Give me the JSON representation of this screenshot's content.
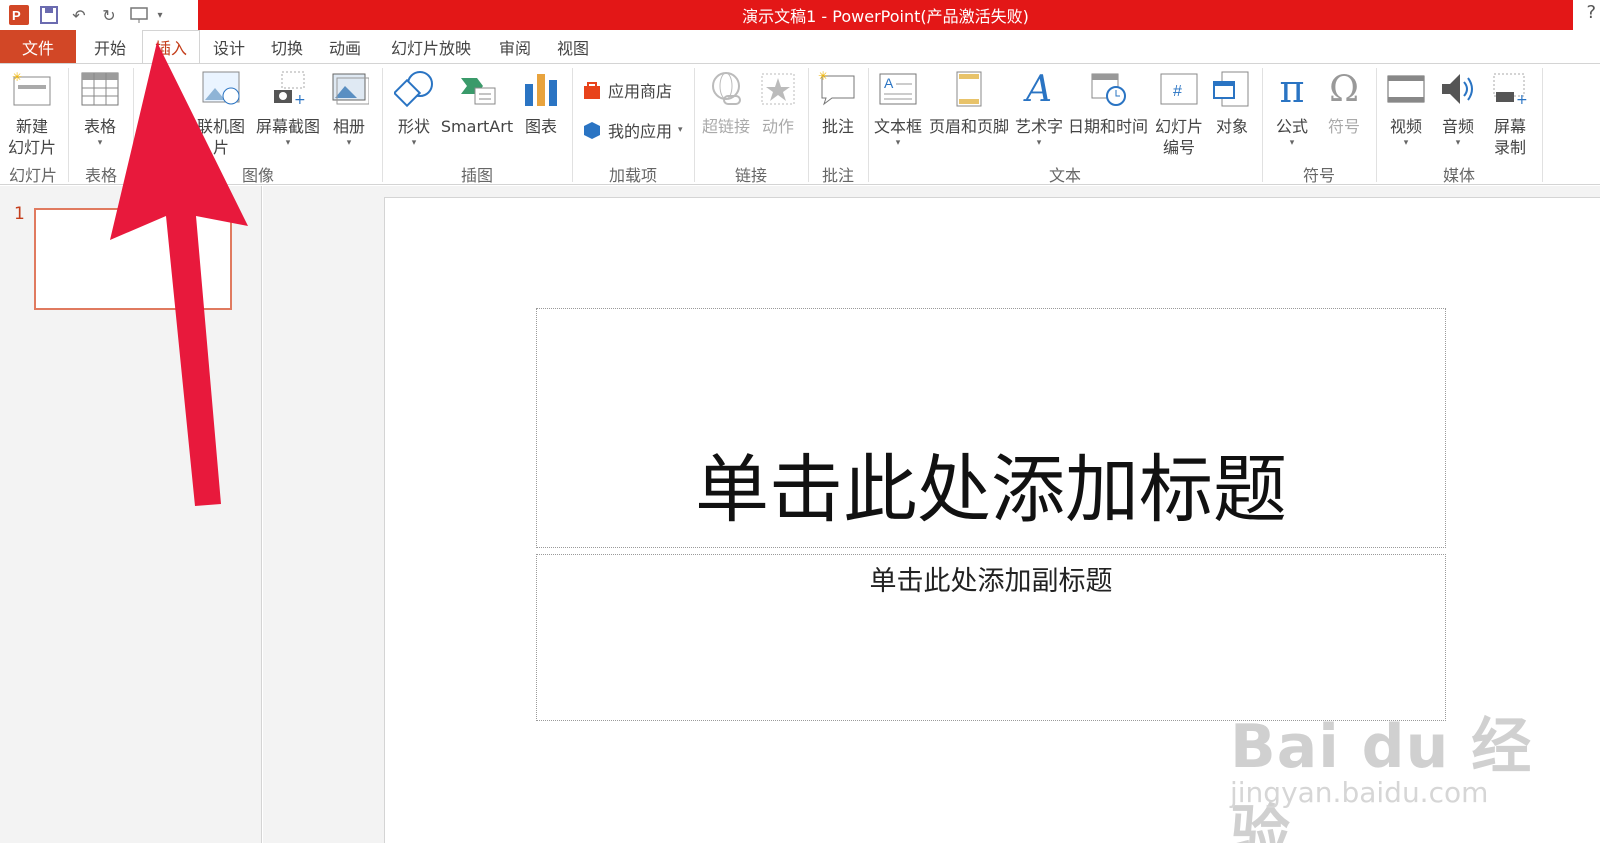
{
  "titlebar": {
    "title": "演示文稿1 -  PowerPoint(产品激活失败)",
    "help": "?"
  },
  "tabs": [
    "文件",
    "开始",
    "插入",
    "设计",
    "切换",
    "动画",
    "幻灯片放映",
    "审阅",
    "视图"
  ],
  "ribbon": {
    "buttons": {
      "new_slide": "新建\n幻灯片",
      "table": "表格",
      "online_pictures": "联机图片",
      "screenshot": "屏幕截图",
      "album": "相册",
      "shapes": "形状",
      "smartart": "SmartArt",
      "chart": "图表",
      "store": "应用商店",
      "my_apps": "我的应用",
      "hyperlink": "超链接",
      "action": "动作",
      "comment": "批注",
      "textbox": "文本框",
      "header_footer": "页眉和页脚",
      "wordart": "艺术字",
      "datetime": "日期和时间",
      "slide_number": "幻灯片\n编号",
      "object": "对象",
      "equation": "公式",
      "symbol": "符号",
      "video": "视频",
      "audio": "音频",
      "screen_record": "屏幕\n录制"
    },
    "groups": {
      "slides": "幻灯片",
      "tables": "表格",
      "images": "图像",
      "illustrations": "插图",
      "addins": "加载项",
      "links": "链接",
      "comments": "批注",
      "text": "文本",
      "symbols": "符号",
      "media": "媒体"
    }
  },
  "thumbs": {
    "number": "1"
  },
  "slide": {
    "title_placeholder": "单击此处添加标题",
    "subtitle_placeholder": "单击此处添加副标题"
  },
  "watermark": {
    "brand": "Bai du 经验",
    "url": "jingyan.baidu.com"
  },
  "colors": {
    "title_bar": "#e31717",
    "file_tab": "#d24726",
    "accent": "#c43e1c",
    "arrow": "#e8193c"
  }
}
